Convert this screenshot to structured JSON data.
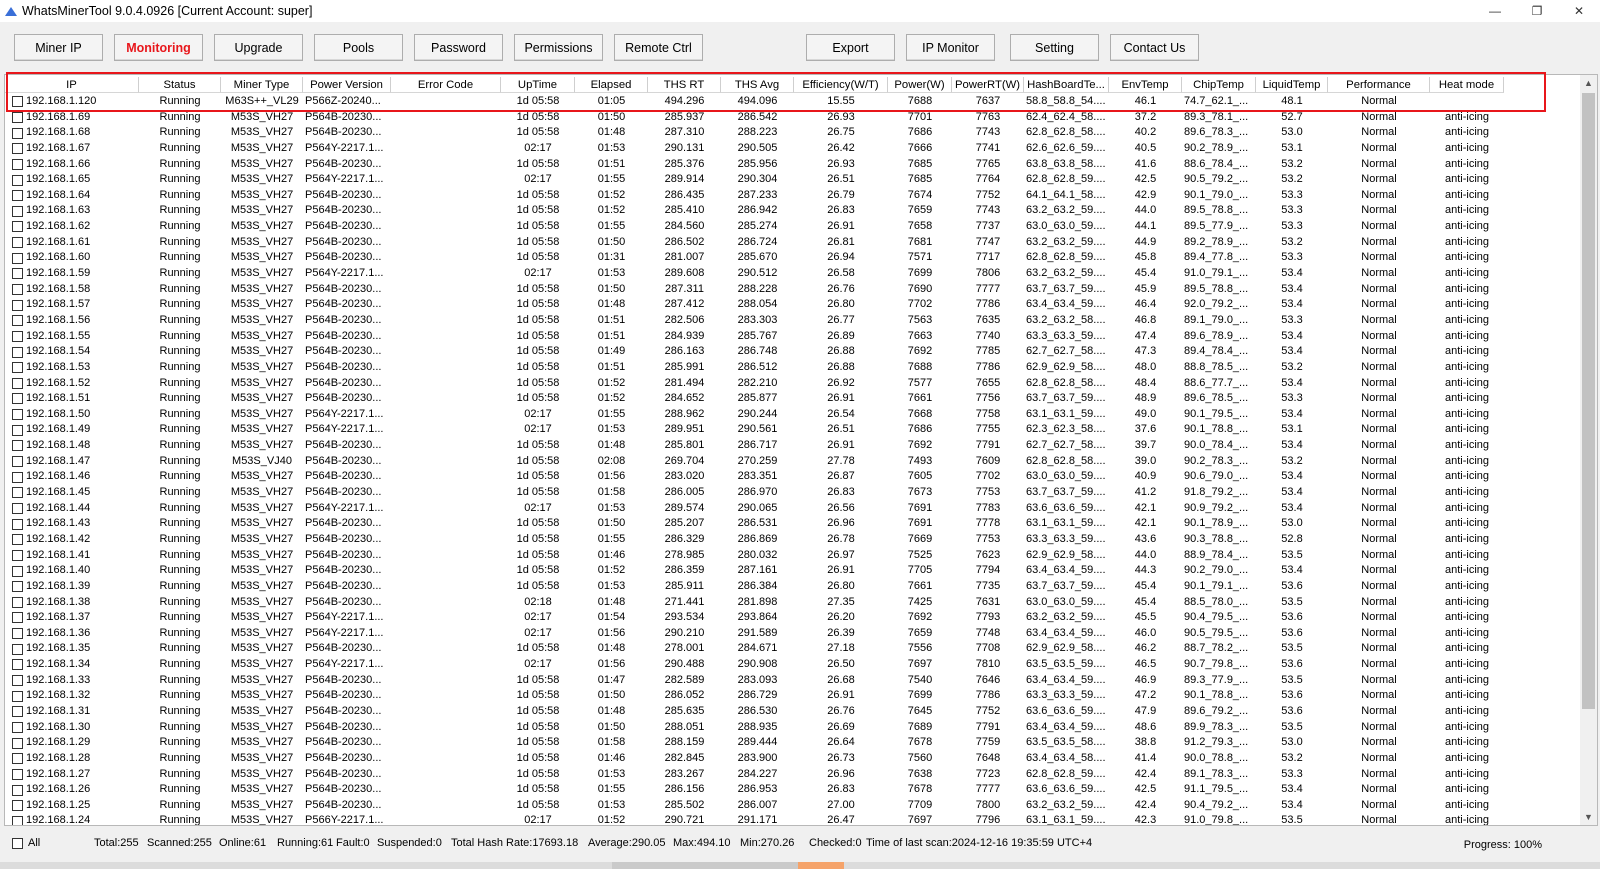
{
  "window": {
    "title": "WhatsMinerTool 9.0.4.0926 [Current Account: super]",
    "min": "—",
    "restore": "❐",
    "close": "✕"
  },
  "toolbar": [
    {
      "label": "Miner IP"
    },
    {
      "label": "Monitoring"
    },
    {
      "label": "Upgrade"
    },
    {
      "label": "Pools"
    },
    {
      "label": "Password"
    },
    {
      "label": "Permissions"
    },
    {
      "label": "Remote Ctrl"
    },
    {
      "label": "Export"
    },
    {
      "label": "IP Monitor"
    },
    {
      "label": "Setting"
    },
    {
      "label": "Contact Us"
    }
  ],
  "columns": [
    "IP",
    "Status",
    "Miner Type",
    "Power Version",
    "Error Code",
    "UpTime",
    "Elapsed",
    "THS RT",
    "THS Avg",
    "Efficiency(W/T)",
    "Power(W)",
    "PowerRT(W)",
    "HashBoardTe...",
    "EnvTemp",
    "ChipTemp",
    "LiquidTemp",
    "Performance",
    "Heat mode"
  ],
  "rows": [
    [
      "192.168.1.120",
      "Running",
      "M63S++_VL29",
      "P566Z-20240...",
      "",
      "1d 05:58",
      "01:05",
      "494.296",
      "494.096",
      "15.55",
      "7688",
      "7637",
      "58.8_58.8_54....",
      "46.1",
      "74.7_62.1_...",
      "48.1",
      "Normal",
      ""
    ],
    [
      "192.168.1.69",
      "Running",
      "M53S_VH27",
      "P564B-20230...",
      "",
      "1d 05:58",
      "01:50",
      "285.937",
      "286.542",
      "26.93",
      "7701",
      "7763",
      "62.4_62.4_58....",
      "37.2",
      "89.3_78.1_...",
      "52.7",
      "Normal",
      "anti-icing"
    ],
    [
      "192.168.1.68",
      "Running",
      "M53S_VH27",
      "P564B-20230...",
      "",
      "1d 05:58",
      "01:48",
      "287.310",
      "288.223",
      "26.75",
      "7686",
      "7743",
      "62.8_62.8_58....",
      "40.2",
      "89.6_78.3_...",
      "53.0",
      "Normal",
      "anti-icing"
    ],
    [
      "192.168.1.67",
      "Running",
      "M53S_VH27",
      "P564Y-2217.1...",
      "",
      "02:17",
      "01:53",
      "290.131",
      "290.505",
      "26.42",
      "7666",
      "7741",
      "62.6_62.6_59....",
      "40.5",
      "90.2_78.9_...",
      "53.1",
      "Normal",
      "anti-icing"
    ],
    [
      "192.168.1.66",
      "Running",
      "M53S_VH27",
      "P564B-20230...",
      "",
      "1d 05:58",
      "01:51",
      "285.376",
      "285.956",
      "26.93",
      "7685",
      "7765",
      "63.8_63.8_58....",
      "41.6",
      "88.6_78.4_...",
      "53.2",
      "Normal",
      "anti-icing"
    ],
    [
      "192.168.1.65",
      "Running",
      "M53S_VH27",
      "P564Y-2217.1...",
      "",
      "02:17",
      "01:55",
      "289.914",
      "290.304",
      "26.51",
      "7685",
      "7764",
      "62.8_62.8_59....",
      "42.5",
      "90.5_79.2_...",
      "53.2",
      "Normal",
      "anti-icing"
    ],
    [
      "192.168.1.64",
      "Running",
      "M53S_VH27",
      "P564B-20230...",
      "",
      "1d 05:58",
      "01:52",
      "286.435",
      "287.233",
      "26.79",
      "7674",
      "7752",
      "64.1_64.1_58....",
      "42.9",
      "90.1_79.0_...",
      "53.3",
      "Normal",
      "anti-icing"
    ],
    [
      "192.168.1.63",
      "Running",
      "M53S_VH27",
      "P564B-20230...",
      "",
      "1d 05:58",
      "01:52",
      "285.410",
      "286.942",
      "26.83",
      "7659",
      "7743",
      "63.2_63.2_59....",
      "44.0",
      "89.5_78.8_...",
      "53.3",
      "Normal",
      "anti-icing"
    ],
    [
      "192.168.1.62",
      "Running",
      "M53S_VH27",
      "P564B-20230...",
      "",
      "1d 05:58",
      "01:55",
      "284.560",
      "285.274",
      "26.91",
      "7658",
      "7737",
      "63.0_63.0_59....",
      "44.1",
      "89.5_77.9_...",
      "53.3",
      "Normal",
      "anti-icing"
    ],
    [
      "192.168.1.61",
      "Running",
      "M53S_VH27",
      "P564B-20230...",
      "",
      "1d 05:58",
      "01:50",
      "286.502",
      "286.724",
      "26.81",
      "7681",
      "7747",
      "63.2_63.2_59....",
      "44.9",
      "89.2_78.9_...",
      "53.2",
      "Normal",
      "anti-icing"
    ],
    [
      "192.168.1.60",
      "Running",
      "M53S_VH27",
      "P564B-20230...",
      "",
      "1d 05:58",
      "01:31",
      "281.007",
      "285.670",
      "26.94",
      "7571",
      "7717",
      "62.8_62.8_59....",
      "45.8",
      "89.4_77.8_...",
      "53.3",
      "Normal",
      "anti-icing"
    ],
    [
      "192.168.1.59",
      "Running",
      "M53S_VH27",
      "P564Y-2217.1...",
      "",
      "02:17",
      "01:53",
      "289.608",
      "290.512",
      "26.58",
      "7699",
      "7806",
      "63.2_63.2_59....",
      "45.4",
      "91.0_79.1_...",
      "53.4",
      "Normal",
      "anti-icing"
    ],
    [
      "192.168.1.58",
      "Running",
      "M53S_VH27",
      "P564B-20230...",
      "",
      "1d 05:58",
      "01:50",
      "287.311",
      "288.228",
      "26.76",
      "7690",
      "7777",
      "63.7_63.7_59....",
      "45.9",
      "89.5_78.8_...",
      "53.4",
      "Normal",
      "anti-icing"
    ],
    [
      "192.168.1.57",
      "Running",
      "M53S_VH27",
      "P564B-20230...",
      "",
      "1d 05:58",
      "01:48",
      "287.412",
      "288.054",
      "26.80",
      "7702",
      "7786",
      "63.4_63.4_59....",
      "46.4",
      "92.0_79.2_...",
      "53.4",
      "Normal",
      "anti-icing"
    ],
    [
      "192.168.1.56",
      "Running",
      "M53S_VH27",
      "P564B-20230...",
      "",
      "1d 05:58",
      "01:51",
      "282.506",
      "283.303",
      "26.77",
      "7563",
      "7635",
      "63.2_63.2_58....",
      "46.8",
      "89.1_79.0_...",
      "53.3",
      "Normal",
      "anti-icing"
    ],
    [
      "192.168.1.55",
      "Running",
      "M53S_VH27",
      "P564B-20230...",
      "",
      "1d 05:58",
      "01:51",
      "284.939",
      "285.767",
      "26.89",
      "7663",
      "7740",
      "63.3_63.3_59....",
      "47.4",
      "89.6_78.9_...",
      "53.4",
      "Normal",
      "anti-icing"
    ],
    [
      "192.168.1.54",
      "Running",
      "M53S_VH27",
      "P564B-20230...",
      "",
      "1d 05:58",
      "01:49",
      "286.163",
      "286.748",
      "26.88",
      "7692",
      "7785",
      "62.7_62.7_58....",
      "47.3",
      "89.4_78.4_...",
      "53.4",
      "Normal",
      "anti-icing"
    ],
    [
      "192.168.1.53",
      "Running",
      "M53S_VH27",
      "P564B-20230...",
      "",
      "1d 05:58",
      "01:51",
      "285.991",
      "286.512",
      "26.88",
      "7688",
      "7786",
      "62.9_62.9_58....",
      "48.0",
      "88.8_78.5_...",
      "53.2",
      "Normal",
      "anti-icing"
    ],
    [
      "192.168.1.52",
      "Running",
      "M53S_VH27",
      "P564B-20230...",
      "",
      "1d 05:58",
      "01:52",
      "281.494",
      "282.210",
      "26.92",
      "7577",
      "7655",
      "62.8_62.8_58....",
      "48.4",
      "88.6_77.7_...",
      "53.4",
      "Normal",
      "anti-icing"
    ],
    [
      "192.168.1.51",
      "Running",
      "M53S_VH27",
      "P564B-20230...",
      "",
      "1d 05:58",
      "01:52",
      "284.652",
      "285.877",
      "26.91",
      "7661",
      "7756",
      "63.7_63.7_59....",
      "48.9",
      "89.6_78.5_...",
      "53.3",
      "Normal",
      "anti-icing"
    ],
    [
      "192.168.1.50",
      "Running",
      "M53S_VH27",
      "P564Y-2217.1...",
      "",
      "02:17",
      "01:55",
      "288.962",
      "290.244",
      "26.54",
      "7668",
      "7758",
      "63.1_63.1_59....",
      "49.0",
      "90.1_79.5_...",
      "53.4",
      "Normal",
      "anti-icing"
    ],
    [
      "192.168.1.49",
      "Running",
      "M53S_VH27",
      "P564Y-2217.1...",
      "",
      "02:17",
      "01:53",
      "289.951",
      "290.561",
      "26.51",
      "7686",
      "7755",
      "62.3_62.3_58....",
      "37.6",
      "90.1_78.8_...",
      "53.1",
      "Normal",
      "anti-icing"
    ],
    [
      "192.168.1.48",
      "Running",
      "M53S_VH27",
      "P564B-20230...",
      "",
      "1d 05:58",
      "01:48",
      "285.801",
      "286.717",
      "26.91",
      "7692",
      "7791",
      "62.7_62.7_58....",
      "39.7",
      "90.0_78.4_...",
      "53.4",
      "Normal",
      "anti-icing"
    ],
    [
      "192.168.1.47",
      "Running",
      "M53S_VJ40",
      "P564B-20230...",
      "",
      "1d 05:58",
      "02:08",
      "269.704",
      "270.259",
      "27.78",
      "7493",
      "7609",
      "62.8_62.8_58....",
      "39.0",
      "90.2_78.3_...",
      "53.2",
      "Normal",
      "anti-icing"
    ],
    [
      "192.168.1.46",
      "Running",
      "M53S_VH27",
      "P564B-20230...",
      "",
      "1d 05:58",
      "01:56",
      "283.020",
      "283.351",
      "26.87",
      "7605",
      "7702",
      "63.0_63.0_59....",
      "40.9",
      "90.6_79.0_...",
      "53.4",
      "Normal",
      "anti-icing"
    ],
    [
      "192.168.1.45",
      "Running",
      "M53S_VH27",
      "P564B-20230...",
      "",
      "1d 05:58",
      "01:58",
      "286.005",
      "286.970",
      "26.83",
      "7673",
      "7753",
      "63.7_63.7_59....",
      "41.2",
      "91.8_79.2_...",
      "53.4",
      "Normal",
      "anti-icing"
    ],
    [
      "192.168.1.44",
      "Running",
      "M53S_VH27",
      "P564Y-2217.1...",
      "",
      "02:17",
      "01:53",
      "289.574",
      "290.065",
      "26.56",
      "7691",
      "7783",
      "63.6_63.6_59....",
      "42.1",
      "90.9_79.2_...",
      "53.4",
      "Normal",
      "anti-icing"
    ],
    [
      "192.168.1.43",
      "Running",
      "M53S_VH27",
      "P564B-20230...",
      "",
      "1d 05:58",
      "01:50",
      "285.207",
      "286.531",
      "26.96",
      "7691",
      "7778",
      "63.1_63.1_59....",
      "42.1",
      "90.1_78.9_...",
      "53.0",
      "Normal",
      "anti-icing"
    ],
    [
      "192.168.1.42",
      "Running",
      "M53S_VH27",
      "P564B-20230...",
      "",
      "1d 05:58",
      "01:55",
      "286.329",
      "286.869",
      "26.78",
      "7669",
      "7753",
      "63.3_63.3_59....",
      "43.6",
      "90.3_78.8_...",
      "52.8",
      "Normal",
      "anti-icing"
    ],
    [
      "192.168.1.41",
      "Running",
      "M53S_VH27",
      "P564B-20230...",
      "",
      "1d 05:58",
      "01:46",
      "278.985",
      "280.032",
      "26.97",
      "7525",
      "7623",
      "62.9_62.9_58....",
      "44.0",
      "88.9_78.4_...",
      "53.5",
      "Normal",
      "anti-icing"
    ],
    [
      "192.168.1.40",
      "Running",
      "M53S_VH27",
      "P564B-20230...",
      "",
      "1d 05:58",
      "01:52",
      "286.359",
      "287.161",
      "26.91",
      "7705",
      "7794",
      "63.4_63.4_59....",
      "44.3",
      "90.2_79.0_...",
      "53.4",
      "Normal",
      "anti-icing"
    ],
    [
      "192.168.1.39",
      "Running",
      "M53S_VH27",
      "P564B-20230...",
      "",
      "1d 05:58",
      "01:53",
      "285.911",
      "286.384",
      "26.80",
      "7661",
      "7735",
      "63.7_63.7_59....",
      "45.4",
      "90.1_79.1_...",
      "53.6",
      "Normal",
      "anti-icing"
    ],
    [
      "192.168.1.38",
      "Running",
      "M53S_VH27",
      "P564B-20230...",
      "",
      "02:18",
      "01:48",
      "271.441",
      "281.898",
      "27.35",
      "7425",
      "7631",
      "63.0_63.0_59....",
      "45.4",
      "88.5_78.0_...",
      "53.5",
      "Normal",
      "anti-icing"
    ],
    [
      "192.168.1.37",
      "Running",
      "M53S_VH27",
      "P564Y-2217.1...",
      "",
      "02:17",
      "01:54",
      "293.534",
      "293.864",
      "26.20",
      "7692",
      "7793",
      "63.2_63.2_59....",
      "45.5",
      "90.4_79.5_...",
      "53.6",
      "Normal",
      "anti-icing"
    ],
    [
      "192.168.1.36",
      "Running",
      "M53S_VH27",
      "P564Y-2217.1...",
      "",
      "02:17",
      "01:56",
      "290.210",
      "291.589",
      "26.39",
      "7659",
      "7748",
      "63.4_63.4_59....",
      "46.0",
      "90.5_79.5_...",
      "53.6",
      "Normal",
      "anti-icing"
    ],
    [
      "192.168.1.35",
      "Running",
      "M53S_VH27",
      "P564B-20230...",
      "",
      "1d 05:58",
      "01:48",
      "278.001",
      "284.671",
      "27.18",
      "7556",
      "7708",
      "62.9_62.9_58....",
      "46.2",
      "88.7_78.2_...",
      "53.5",
      "Normal",
      "anti-icing"
    ],
    [
      "192.168.1.34",
      "Running",
      "M53S_VH27",
      "P564Y-2217.1...",
      "",
      "02:17",
      "01:56",
      "290.488",
      "290.908",
      "26.50",
      "7697",
      "7810",
      "63.5_63.5_59....",
      "46.5",
      "90.7_79.8_...",
      "53.6",
      "Normal",
      "anti-icing"
    ],
    [
      "192.168.1.33",
      "Running",
      "M53S_VH27",
      "P564B-20230...",
      "",
      "1d 05:58",
      "01:47",
      "282.589",
      "283.093",
      "26.68",
      "7540",
      "7646",
      "63.4_63.4_59....",
      "46.9",
      "89.3_77.9_...",
      "53.5",
      "Normal",
      "anti-icing"
    ],
    [
      "192.168.1.32",
      "Running",
      "M53S_VH27",
      "P564B-20230...",
      "",
      "1d 05:58",
      "01:50",
      "286.052",
      "286.729",
      "26.91",
      "7699",
      "7786",
      "63.3_63.3_59....",
      "47.2",
      "90.1_78.8_...",
      "53.6",
      "Normal",
      "anti-icing"
    ],
    [
      "192.168.1.31",
      "Running",
      "M53S_VH27",
      "P564B-20230...",
      "",
      "1d 05:58",
      "01:48",
      "285.635",
      "286.530",
      "26.76",
      "7645",
      "7752",
      "63.6_63.6_59....",
      "47.9",
      "89.6_79.2_...",
      "53.6",
      "Normal",
      "anti-icing"
    ],
    [
      "192.168.1.30",
      "Running",
      "M53S_VH27",
      "P564B-20230...",
      "",
      "1d 05:58",
      "01:50",
      "288.051",
      "288.935",
      "26.69",
      "7689",
      "7791",
      "63.4_63.4_59....",
      "48.6",
      "89.9_78.3_...",
      "53.5",
      "Normal",
      "anti-icing"
    ],
    [
      "192.168.1.29",
      "Running",
      "M53S_VH27",
      "P564B-20230...",
      "",
      "1d 05:58",
      "01:58",
      "288.159",
      "289.444",
      "26.64",
      "7678",
      "7759",
      "63.5_63.5_58....",
      "38.8",
      "91.2_79.3_...",
      "53.0",
      "Normal",
      "anti-icing"
    ],
    [
      "192.168.1.28",
      "Running",
      "M53S_VH27",
      "P564B-20230...",
      "",
      "1d 05:58",
      "01:46",
      "282.845",
      "283.900",
      "26.73",
      "7560",
      "7648",
      "63.4_63.4_58....",
      "41.4",
      "90.0_78.8_...",
      "53.2",
      "Normal",
      "anti-icing"
    ],
    [
      "192.168.1.27",
      "Running",
      "M53S_VH27",
      "P564B-20230...",
      "",
      "1d 05:58",
      "01:53",
      "283.267",
      "284.227",
      "26.96",
      "7638",
      "7723",
      "62.8_62.8_59....",
      "42.4",
      "89.1_78.3_...",
      "53.3",
      "Normal",
      "anti-icing"
    ],
    [
      "192.168.1.26",
      "Running",
      "M53S_VH27",
      "P564B-20230...",
      "",
      "1d 05:58",
      "01:55",
      "286.156",
      "286.953",
      "26.83",
      "7678",
      "7777",
      "63.6_63.6_59....",
      "42.5",
      "91.1_79.5_...",
      "53.4",
      "Normal",
      "anti-icing"
    ],
    [
      "192.168.1.25",
      "Running",
      "M53S_VH27",
      "P564B-20230...",
      "",
      "1d 05:58",
      "01:53",
      "285.502",
      "286.007",
      "27.00",
      "7709",
      "7800",
      "63.2_63.2_59....",
      "42.4",
      "90.4_79.2_...",
      "53.4",
      "Normal",
      "anti-icing"
    ],
    [
      "192.168.1.24",
      "Running",
      "M53S_VH27",
      "P566Y-2217.1...",
      "",
      "02:17",
      "01:52",
      "290.721",
      "291.171",
      "26.47",
      "7697",
      "7796",
      "63.1_63.1_59....",
      "42.3",
      "91.0_79.8_...",
      "53.5",
      "Normal",
      "anti-icing"
    ]
  ],
  "status": {
    "all": "All",
    "total": "Total:255",
    "scanned": "Scanned:255",
    "online": "Online:61",
    "running": "Running:61",
    "fault": "Fault:0",
    "suspended": "Suspended:0",
    "hashrate": "Total Hash Rate:17693.18",
    "average": "Average:290.05",
    "max": "Max:494.10",
    "min": "Min:270.26",
    "checked": "Checked:0",
    "lastscan": "Time of last scan:2024-12-16 19:35:59 UTC+4",
    "progress": "Progress: 100%"
  },
  "colors": {
    "active_tab": "#e8161b",
    "highlight": "#e8161b"
  }
}
